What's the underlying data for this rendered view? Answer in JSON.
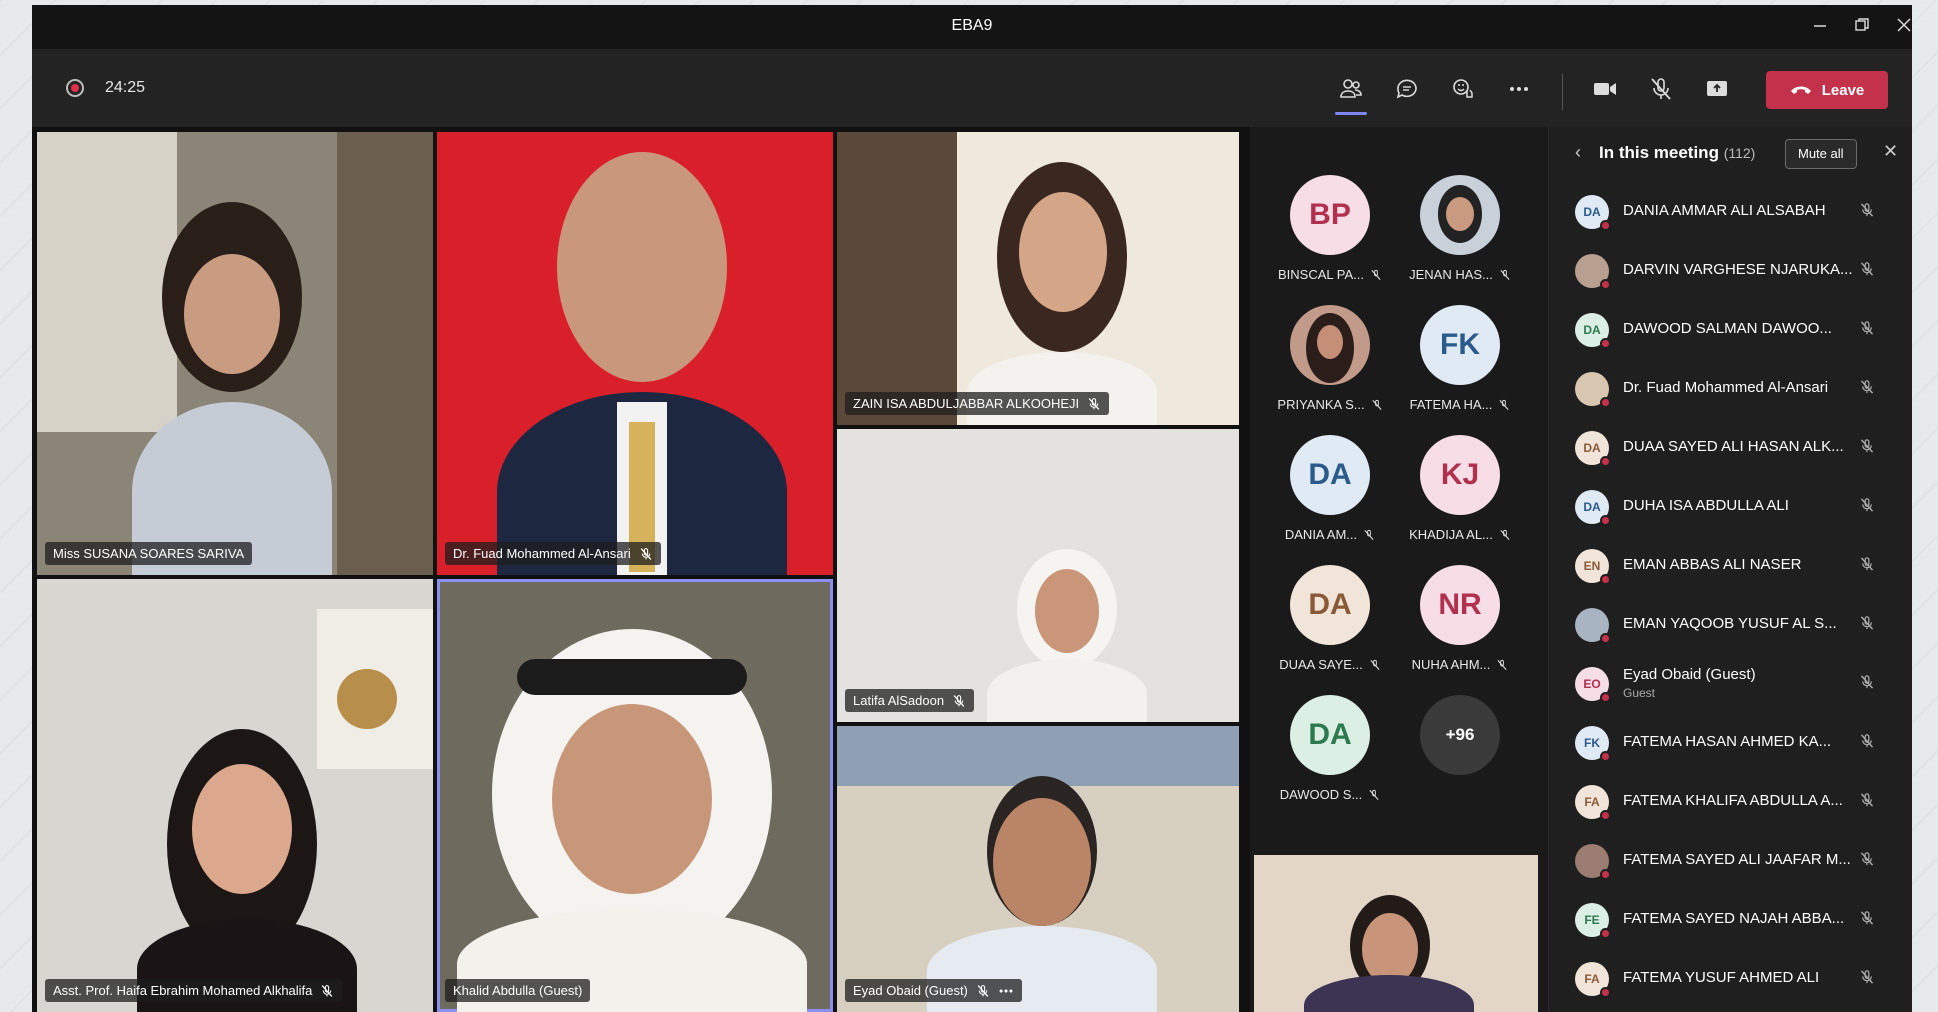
{
  "window": {
    "title": "EBA9"
  },
  "toolbar": {
    "timer": "24:25",
    "leave_label": "Leave"
  },
  "tiles": [
    {
      "name": "Miss SUSANA SOARES SARIVA",
      "muted": false
    },
    {
      "name": "Dr. Fuad Mohammed Al-Ansari",
      "muted": true
    },
    {
      "name": "ZAIN ISA ABDULJABBAR ALKOOHEJI",
      "muted": true
    },
    {
      "name": "Latifa AlSadoon",
      "muted": true
    },
    {
      "name": "Asst. Prof. Haifa Ebrahim Mohamed Alkhalifa",
      "muted": true
    },
    {
      "name": "Khalid Abdulla (Guest)",
      "muted": false
    },
    {
      "name": "Eyad Obaid (Guest)",
      "muted": true
    }
  ],
  "avatars": [
    {
      "initials": "BP",
      "name": "BINSCAL PA...",
      "bg": "#f6dde6",
      "fg": "#b0304e"
    },
    {
      "initials": "",
      "name": "JENAN HAS...",
      "bg": "#c8d0da",
      "fg": "#333333"
    },
    {
      "initials": "",
      "name": "PRIYANKA S...",
      "bg": "#c29a8a",
      "fg": "#333333"
    },
    {
      "initials": "FK",
      "name": "FATEMA HA...",
      "bg": "#dfeaf5",
      "fg": "#2b5b8a"
    },
    {
      "initials": "DA",
      "name": "DANIA AM...",
      "bg": "#dfeaf5",
      "fg": "#2b5b8a"
    },
    {
      "initials": "KJ",
      "name": "KHADIJA AL...",
      "bg": "#f6dde6",
      "fg": "#b0304e"
    },
    {
      "initials": "DA",
      "name": "DUAA SAYE...",
      "bg": "#f1e4d8",
      "fg": "#8a5a38"
    },
    {
      "initials": "NR",
      "name": "NUHA AHM...",
      "bg": "#f6dde6",
      "fg": "#b0304e"
    },
    {
      "initials": "DA",
      "name": "DAWOOD S...",
      "bg": "#dcefe4",
      "fg": "#2c7a4e"
    },
    {
      "initials": "+96",
      "name": "",
      "bg": "#3a3a3a",
      "fg": "#ffffff"
    }
  ],
  "panel": {
    "title": "In this meeting",
    "count": "(112)",
    "mute_all": "Mute all",
    "participants": [
      {
        "initials": "DA",
        "name": "DANIA AMMAR ALI ALSABAH",
        "sub": "",
        "bg": "#dfeaf5",
        "fg": "#2b5b8a"
      },
      {
        "initials": "",
        "name": "DARVIN VARGHESE NJARUKA...",
        "sub": "",
        "bg": "#b8a090",
        "fg": "#333333"
      },
      {
        "initials": "DA",
        "name": "DAWOOD SALMAN DAWOO...",
        "sub": "",
        "bg": "#dcefe4",
        "fg": "#2c7a4e"
      },
      {
        "initials": "",
        "name": "Dr. Fuad Mohammed Al-Ansari",
        "sub": "",
        "bg": "#d8c6b0",
        "fg": "#333333"
      },
      {
        "initials": "DA",
        "name": "DUAA SAYED ALI HASAN ALK...",
        "sub": "",
        "bg": "#f1e4d8",
        "fg": "#8a5a38"
      },
      {
        "initials": "DA",
        "name": "DUHA ISA ABDULLA ALI",
        "sub": "",
        "bg": "#dfeaf5",
        "fg": "#2b5b8a"
      },
      {
        "initials": "EN",
        "name": "EMAN ABBAS ALI NASER",
        "sub": "",
        "bg": "#f1e4d8",
        "fg": "#8a5a38"
      },
      {
        "initials": "",
        "name": "EMAN YAQOOB YUSUF AL S...",
        "sub": "",
        "bg": "#a9b4c2",
        "fg": "#333333"
      },
      {
        "initials": "EO",
        "name": "Eyad Obaid (Guest)",
        "sub": "Guest",
        "bg": "#f6dde6",
        "fg": "#b0304e"
      },
      {
        "initials": "FK",
        "name": "FATEMA HASAN AHMED KA...",
        "sub": "",
        "bg": "#dfeaf5",
        "fg": "#2b5b8a"
      },
      {
        "initials": "FA",
        "name": "FATEMA KHALIFA ABDULLA A...",
        "sub": "",
        "bg": "#f1e4d8",
        "fg": "#8a5a38"
      },
      {
        "initials": "",
        "name": "FATEMA SAYED ALI JAAFAR M...",
        "sub": "",
        "bg": "#9a7c70",
        "fg": "#333333"
      },
      {
        "initials": "FE",
        "name": "FATEMA SAYED NAJAH ABBA...",
        "sub": "",
        "bg": "#dcefe4",
        "fg": "#2c7a4e"
      },
      {
        "initials": "FA",
        "name": "FATEMA YUSUF AHMED ALI",
        "sub": "",
        "bg": "#f1e4d8",
        "fg": "#8a5a38"
      }
    ]
  }
}
